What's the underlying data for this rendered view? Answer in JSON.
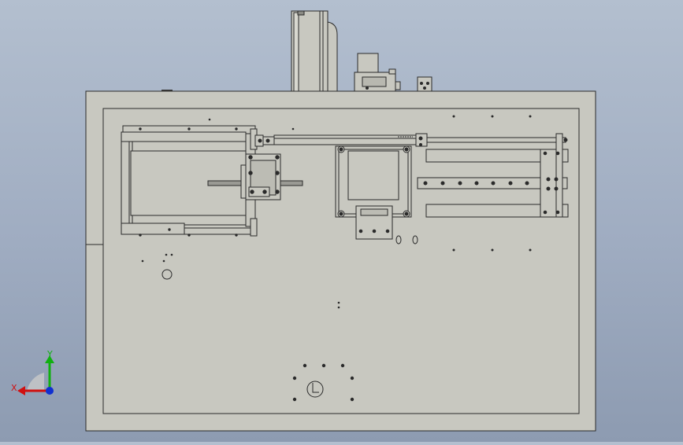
{
  "viewport": {
    "background_top": "#b3bfcf",
    "background_bottom": "#8d9bb1",
    "model_fill": "#c8c8c0",
    "edge_color": "#2a2a2a"
  },
  "triad": {
    "x_label": "X",
    "y_label": "Y",
    "x_color": "#d01010",
    "y_color": "#10b010",
    "z_color": "#1030d0"
  }
}
